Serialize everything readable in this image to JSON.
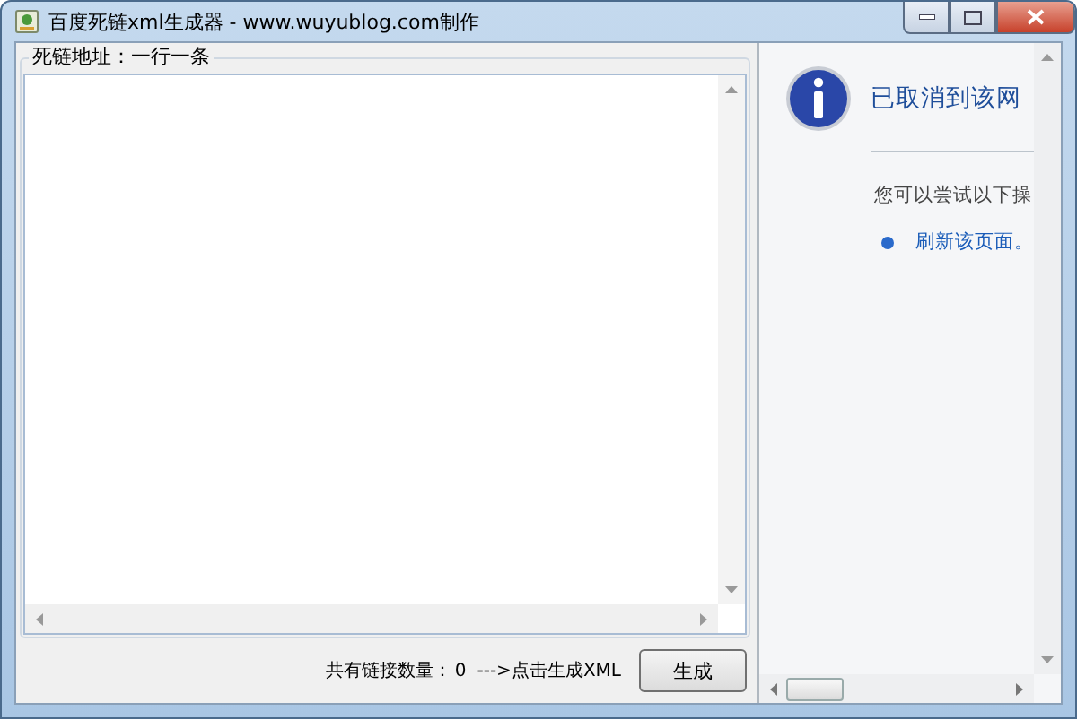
{
  "window": {
    "title": "百度死链xml生成器 - www.wuyublog.com制作"
  },
  "links_group": {
    "label": "死链地址：一行一条"
  },
  "footer": {
    "count_label": "共有链接数量：",
    "count": "0",
    "hint": "--->点击生成XML",
    "generate_button": "生成"
  },
  "browser_panel": {
    "heading": "已取消到该网",
    "subtext": "您可以尝试以下操",
    "actions": [
      "刷新该页面。"
    ]
  }
}
